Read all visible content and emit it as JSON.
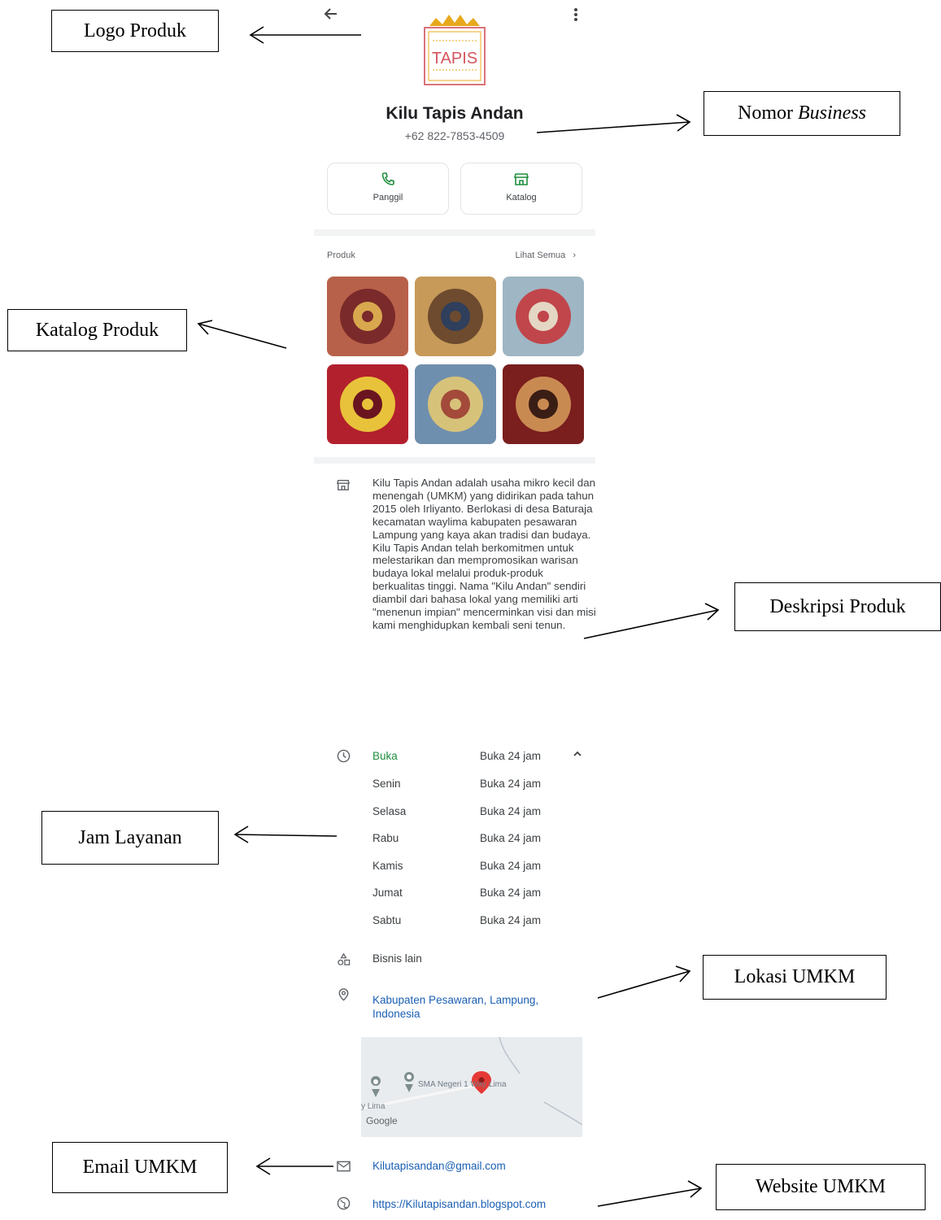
{
  "annotations": {
    "logo": "Logo Produk",
    "phone_prefix": "Nomor ",
    "phone_em": "Business",
    "catalog": "Katalog Produk",
    "description": "Deskripsi Produk",
    "hours": "Jam Layanan",
    "location": "Lokasi UMKM",
    "email": "Email UMKM",
    "website": "Website UMKM"
  },
  "profile": {
    "logo_text": "TAPIS",
    "name": "Kilu Tapis Andan",
    "phone": "+62 822-7853-4509"
  },
  "actions": {
    "call": "Panggil",
    "catalog": "Katalog"
  },
  "products": {
    "title": "Produk",
    "see_all": "Lihat Semua",
    "items": [
      {
        "colors": [
          "#b8614a",
          "#7a2a2a",
          "#d9a84e"
        ]
      },
      {
        "colors": [
          "#c79a5a",
          "#6e4b2e",
          "#2f3f5c"
        ]
      },
      {
        "colors": [
          "#9fb6c4",
          "#c0464b",
          "#e4d7c3"
        ]
      },
      {
        "colors": [
          "#b3202d",
          "#e8c23a",
          "#6a1420"
        ]
      },
      {
        "colors": [
          "#6f8fae",
          "#d7c27a",
          "#a34a3a"
        ]
      },
      {
        "colors": [
          "#7a1e1e",
          "#c98a52",
          "#3a1d14"
        ]
      }
    ]
  },
  "description": "Kilu Tapis Andan adalah usaha mikro kecil dan menengah (UMKM) yang didirikan pada tahun 2015 oleh Irliyanto. Berlokasi di desa Baturaja kecamatan waylima kabupaten pesawaran Lampung yang kaya akan tradisi dan budaya. Kilu Tapis Andan telah berkomitmen untuk melestarikan dan mempromosikan warisan budaya lokal melalui produk-produk berkualitas tinggi. Nama \"Kilu Andan\" sendiri diambil dari bahasa lokal yang memiliki arti \"menenun impian\" mencerminkan visi dan misi kami menghidupkan kembali seni tenun.",
  "hours": {
    "status": "Buka",
    "status_value": "Buka 24 jam",
    "days": [
      {
        "day": "Senin",
        "value": "Buka 24 jam"
      },
      {
        "day": "Selasa",
        "value": "Buka 24 jam"
      },
      {
        "day": "Rabu",
        "value": "Buka 24 jam"
      },
      {
        "day": "Kamis",
        "value": "Buka 24 jam"
      },
      {
        "day": "Jumat",
        "value": "Buka 24 jam"
      },
      {
        "day": "Sabtu",
        "value": "Buka 24 jam"
      }
    ]
  },
  "category": "Bisnis lain",
  "location": {
    "line1": "Kabupaten Pesawaran, Lampung,",
    "line2": "Indonesia"
  },
  "map": {
    "poi": "SMA Negeri 1 Way Lima",
    "place": "y Lima",
    "brand": "Google"
  },
  "email": "Kilutapisandan@gmail.com",
  "website": "https://Kilutapisandan.blogspot.com",
  "colors": {
    "accent_green": "#1e8e3e",
    "link_blue": "#1a5fb4",
    "pin_red": "#e53935"
  }
}
